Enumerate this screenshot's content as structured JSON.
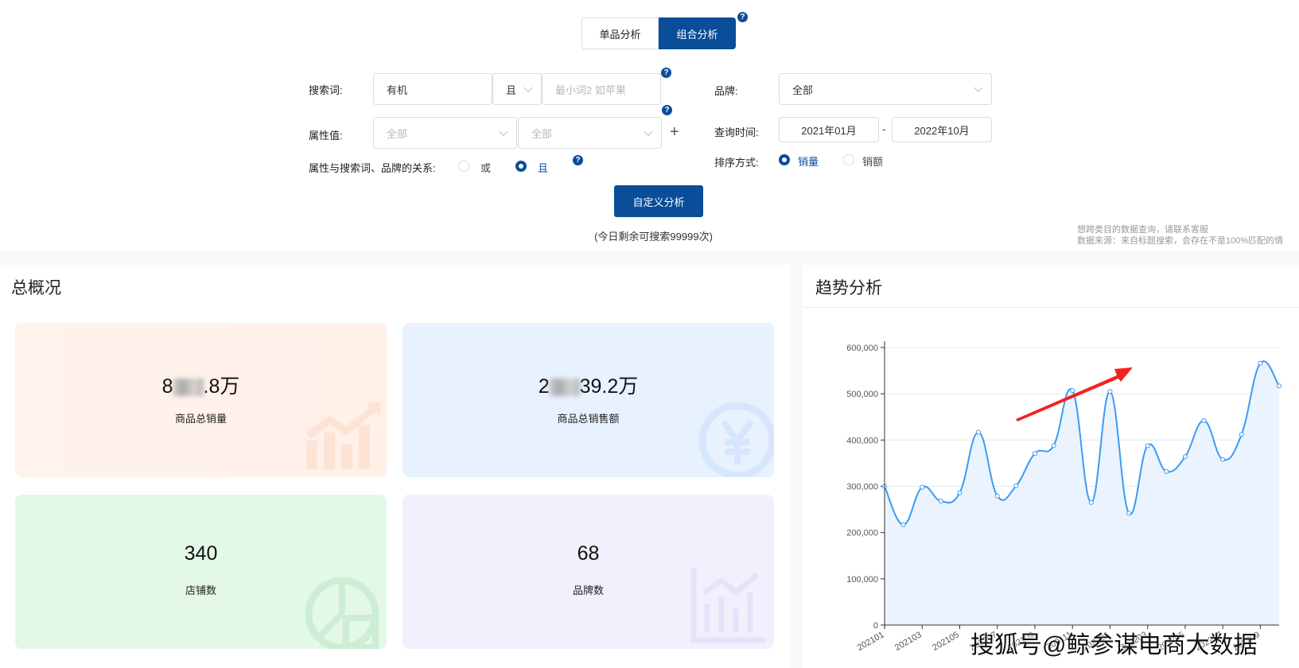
{
  "tabs": [
    {
      "label": "单品分析",
      "active": false
    },
    {
      "label": "组合分析",
      "active": true
    }
  ],
  "help_icon": "?",
  "form": {
    "search_label": "搜索词:",
    "search_value": "有机",
    "logic_value": "且",
    "search2_placeholder": "最小词2 如苹果",
    "attr_label": "属性值:",
    "attr1_value": "全部",
    "attr2_value": "全部",
    "add_icon": "+",
    "relation_label": "属性与搜索词、品牌的关系:",
    "relation_options": [
      {
        "label": "或",
        "selected": false
      },
      {
        "label": "且",
        "selected": true
      }
    ],
    "brand_label": "品牌:",
    "brand_value": "全部",
    "time_label": "查询时间:",
    "time_start": "2021年01月",
    "time_sep": "-",
    "time_end": "2022年10月",
    "sort_label": "排序方式:",
    "sort_options": [
      {
        "label": "销量",
        "selected": true
      },
      {
        "label": "销额",
        "selected": false
      }
    ],
    "submit_label": "自定义分析",
    "remaining": "(今日剩余可搜索99999次)"
  },
  "notes": [
    "想跨类目的数据查询，请联系客服",
    "数据来源：来自标题搜索，会存在不是100%匹配的情"
  ],
  "overview": {
    "title": "总概况",
    "cards": [
      {
        "value_prefix": "8",
        "value_suffix": ".8万",
        "label": "商品总销量",
        "bg": "#fff1ea",
        "icon": "bar-chart-rising-icon"
      },
      {
        "value_prefix": "2",
        "value_suffix": "39.2万",
        "label": "商品总销售额",
        "bg": "#e8f1fe",
        "icon": "yen-icon"
      },
      {
        "value": "340",
        "label": "店铺数",
        "bg": "#e4f8e8",
        "icon": "pie-chart-icon"
      },
      {
        "value": "68",
        "label": "品牌数",
        "bg": "#f3effd",
        "icon": "column-chart-icon"
      }
    ]
  },
  "trend": {
    "title": "趋势分析"
  },
  "chart_data": {
    "type": "area",
    "x": [
      "202101",
      "202102",
      "202103",
      "202104",
      "202105",
      "202106",
      "202107",
      "202108",
      "202109",
      "202110",
      "202111",
      "202112",
      "202201",
      "202202",
      "202203",
      "202204",
      "202205",
      "202206",
      "202207",
      "202208",
      "202209",
      "202210"
    ],
    "x_tick_labels": [
      "202101",
      "202103",
      "202105",
      "202107",
      "202109",
      "202111",
      "202201",
      "202203",
      "202205",
      "202207",
      "202209"
    ],
    "values": [
      300000,
      217000,
      298000,
      268000,
      286000,
      417000,
      279000,
      301000,
      371000,
      388000,
      507000,
      265000,
      505000,
      242000,
      388000,
      332000,
      364000,
      442000,
      358000,
      412000,
      566000,
      517000
    ],
    "ylim": [
      0,
      600000
    ],
    "y_ticks": [
      "0",
      "100,000",
      "200,000",
      "300,000",
      "400,000",
      "500,000",
      "600,000"
    ],
    "smooth": true,
    "grid": true,
    "line_color": "#3b9bf5",
    "fill_color": "#eaf3fe",
    "annotation": "red-upward-arrow"
  },
  "watermark": "搜狐号@鲸参谋电商大数据"
}
